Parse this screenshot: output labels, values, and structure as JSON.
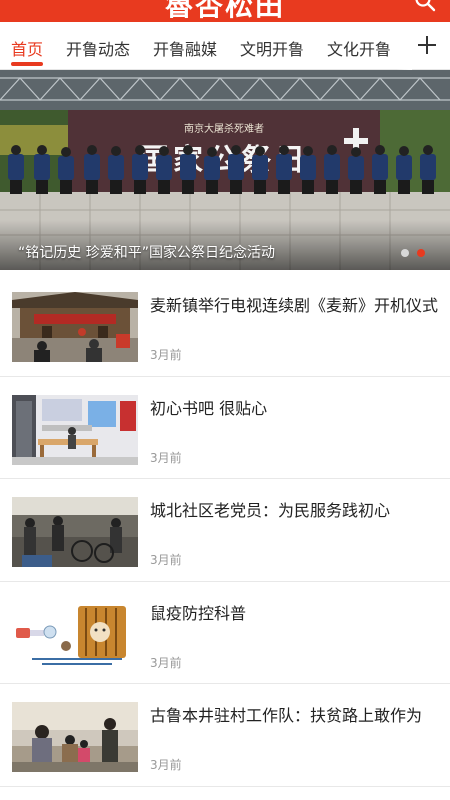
{
  "header": {
    "app_title": "魯杏松田"
  },
  "tabs": [
    {
      "label": "首页",
      "active": true
    },
    {
      "label": "开鲁动态"
    },
    {
      "label": "开鲁融媒"
    },
    {
      "label": "文明开鲁"
    },
    {
      "label": "文化开鲁"
    }
  ],
  "banner": {
    "caption": "“铭记历史 珍爱和平”国家公祭日纪念活动",
    "stage_text": "国家公祭日",
    "stage_subtext": "南京大屠杀死难者",
    "slide_count": 2,
    "active_slide": 2
  },
  "news": [
    {
      "title": "麦新镇举行电视连续剧《麦新》开机仪式",
      "time": "3月前",
      "thumb_icon": "ceremony-photo"
    },
    {
      "title": "初心书吧 很贴心",
      "time": "3月前",
      "thumb_icon": "library-photo"
    },
    {
      "title": "城北社区老党员：为民服务践初心",
      "time": "3月前",
      "thumb_icon": "community-photo"
    },
    {
      "title": "鼠疫防控科普",
      "time": "3月前",
      "thumb_icon": "plague-poster"
    },
    {
      "title": "古鲁本井驻村工作队：扶贫路上敢作为",
      "time": "3月前",
      "thumb_icon": "village-photo"
    }
  ],
  "colors": {
    "brand": "#e83a1f",
    "text": "#222222",
    "muted": "#999999"
  }
}
